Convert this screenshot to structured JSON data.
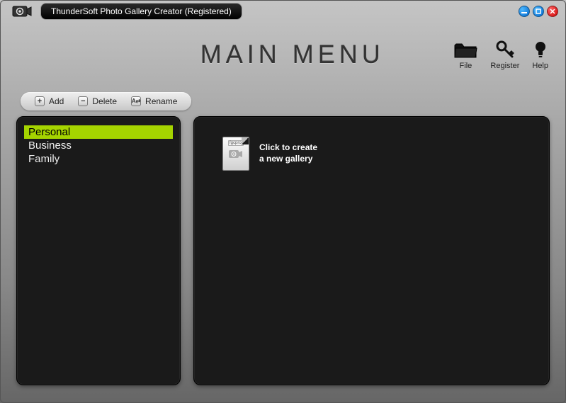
{
  "app": {
    "title": "ThunderSoft Photo Gallery Creator (Registered)"
  },
  "header": {
    "main_title": "MAIN MENU",
    "tools": {
      "file": "File",
      "register": "Register",
      "help": "Help"
    }
  },
  "toolbar": {
    "add": "Add",
    "delete": "Delete",
    "rename": "Rename"
  },
  "categories": [
    {
      "label": "Personal",
      "selected": true
    },
    {
      "label": "Business",
      "selected": false
    },
    {
      "label": "Family",
      "selected": false
    }
  ],
  "gallery": {
    "file_ext": "fgcproj",
    "create_line1": "Click to create",
    "create_line2": "a new gallery"
  }
}
